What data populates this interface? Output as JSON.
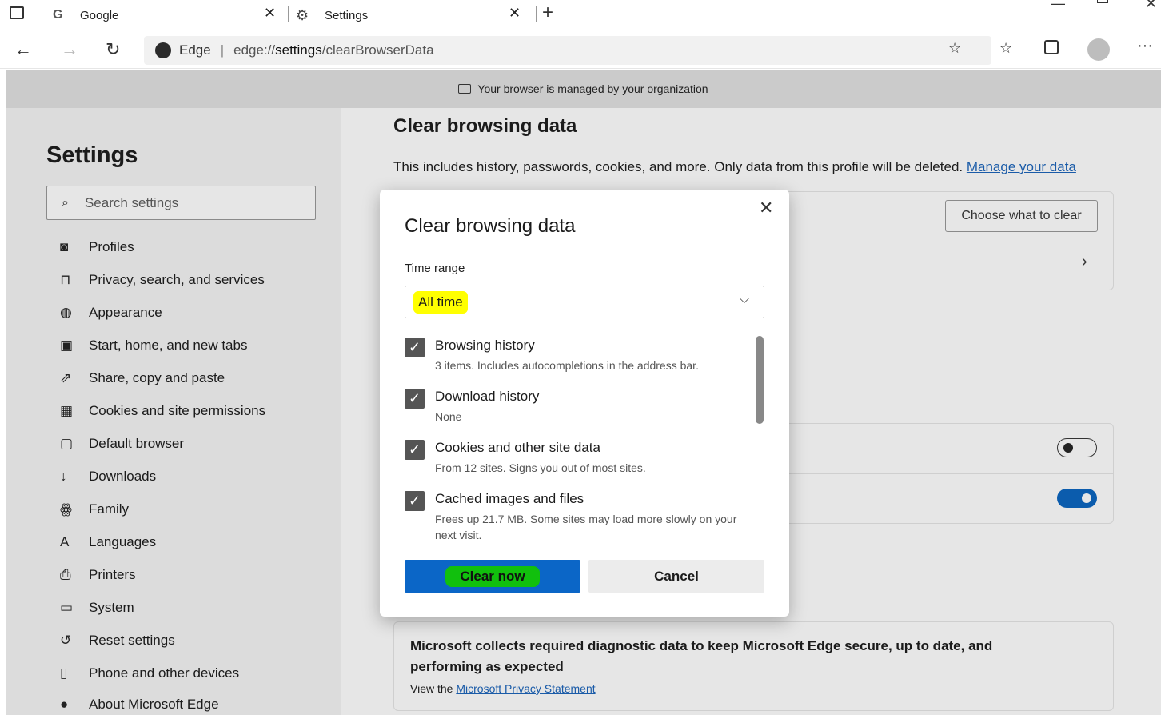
{
  "browser": {
    "tabs": [
      {
        "label": "Google",
        "icon": "google-g-icon"
      },
      {
        "label": "Settings",
        "icon": "gear-icon"
      }
    ],
    "new_tab_label": "+",
    "close_glyph": "✕",
    "address": {
      "brand": "Edge",
      "prefix": "edge://",
      "host": "settings",
      "path": "/clearBrowserData"
    }
  },
  "banner": {
    "text": "Your browser is managed by your organization"
  },
  "sidebar": {
    "title": "Settings",
    "search_placeholder": "Search settings",
    "items": [
      {
        "label": "Profiles",
        "icon": "profile-icon"
      },
      {
        "label": "Privacy, search, and services",
        "icon": "lock-icon"
      },
      {
        "label": "Appearance",
        "icon": "palette-icon"
      },
      {
        "label": "Start, home, and new tabs",
        "icon": "home-tabs-icon"
      },
      {
        "label": "Share, copy and paste",
        "icon": "share-icon"
      },
      {
        "label": "Cookies and site permissions",
        "icon": "cookies-icon"
      },
      {
        "label": "Default browser",
        "icon": "browser-icon"
      },
      {
        "label": "Downloads",
        "icon": "download-icon"
      },
      {
        "label": "Family",
        "icon": "family-icon"
      },
      {
        "label": "Languages",
        "icon": "language-icon"
      },
      {
        "label": "Printers",
        "icon": "printer-icon"
      },
      {
        "label": "System",
        "icon": "system-icon"
      },
      {
        "label": "Reset settings",
        "icon": "reset-icon"
      },
      {
        "label": "Phone and other devices",
        "icon": "phone-icon"
      },
      {
        "label": "About Microsoft Edge",
        "icon": "edge-logo-icon"
      }
    ]
  },
  "main": {
    "title": "Clear browsing data",
    "description": "This includes history, passwords, cookies, and more. Only data from this profile will be deleted.",
    "manage_link": "Manage your data",
    "choose_button": "Choose what to clear",
    "diagnostic": {
      "text": "Microsoft collects required diagnostic data to keep Microsoft Edge secure, up to date, and performing as expected",
      "link_prefix": "View the",
      "link": "Microsoft Privacy Statement"
    }
  },
  "dialog": {
    "title": "Clear browsing data",
    "time_range_label": "Time range",
    "time_range_value": "All time",
    "items": [
      {
        "title": "Browsing history",
        "sub": "3 items. Includes autocompletions in the address bar.",
        "checked": true
      },
      {
        "title": "Download history",
        "sub": "None",
        "checked": true
      },
      {
        "title": "Cookies and other site data",
        "sub": "From 12 sites. Signs you out of most sites.",
        "checked": true
      },
      {
        "title": "Cached images and files",
        "sub": "Frees up 21.7 MB. Some sites may load more slowly on your next visit.",
        "checked": true
      }
    ],
    "clear_button": "Clear now",
    "cancel_button": "Cancel"
  },
  "colors": {
    "accent": "#0b66c7",
    "highlight_yellow": "#ffff00",
    "highlight_green": "#11c00d",
    "link": "#1a5ba8"
  }
}
